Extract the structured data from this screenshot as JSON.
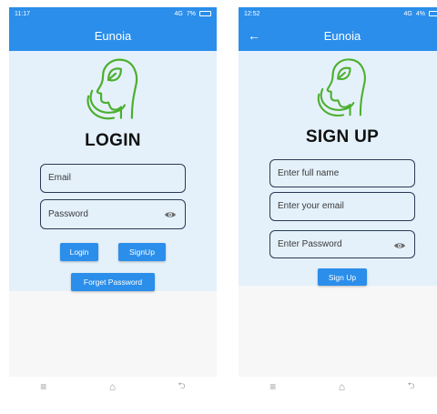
{
  "login_screen": {
    "status": {
      "time": "11:17",
      "signal": "4G",
      "network": "4G",
      "battery": "7%"
    },
    "appbar": {
      "title": "Eunoia"
    },
    "heading": "LOGIN",
    "email_field": {
      "placeholder": "Email"
    },
    "password_field": {
      "placeholder": "Password"
    },
    "login_button": "Login",
    "signup_button": "SignUp",
    "forget_password_button": "Forget Password"
  },
  "signup_screen": {
    "status": {
      "time": "12:52",
      "signal": "4G",
      "network": "4G",
      "battery": "4%"
    },
    "appbar": {
      "title": "Eunoia",
      "back_icon": "←"
    },
    "heading": "SIGN UP",
    "name_field": {
      "placeholder": "Enter full name"
    },
    "email_field": {
      "placeholder": "Enter your email"
    },
    "password_field": {
      "placeholder": "Enter Password"
    },
    "signup_button": "Sign Up"
  },
  "navbar": {
    "menu_icon": "≡",
    "home_icon": "⌂",
    "back_icon": "⮌"
  },
  "colors": {
    "primary": "#2b8eea",
    "background": "#e4f1fb",
    "logo": "#4caf2d",
    "text": "#111111"
  }
}
